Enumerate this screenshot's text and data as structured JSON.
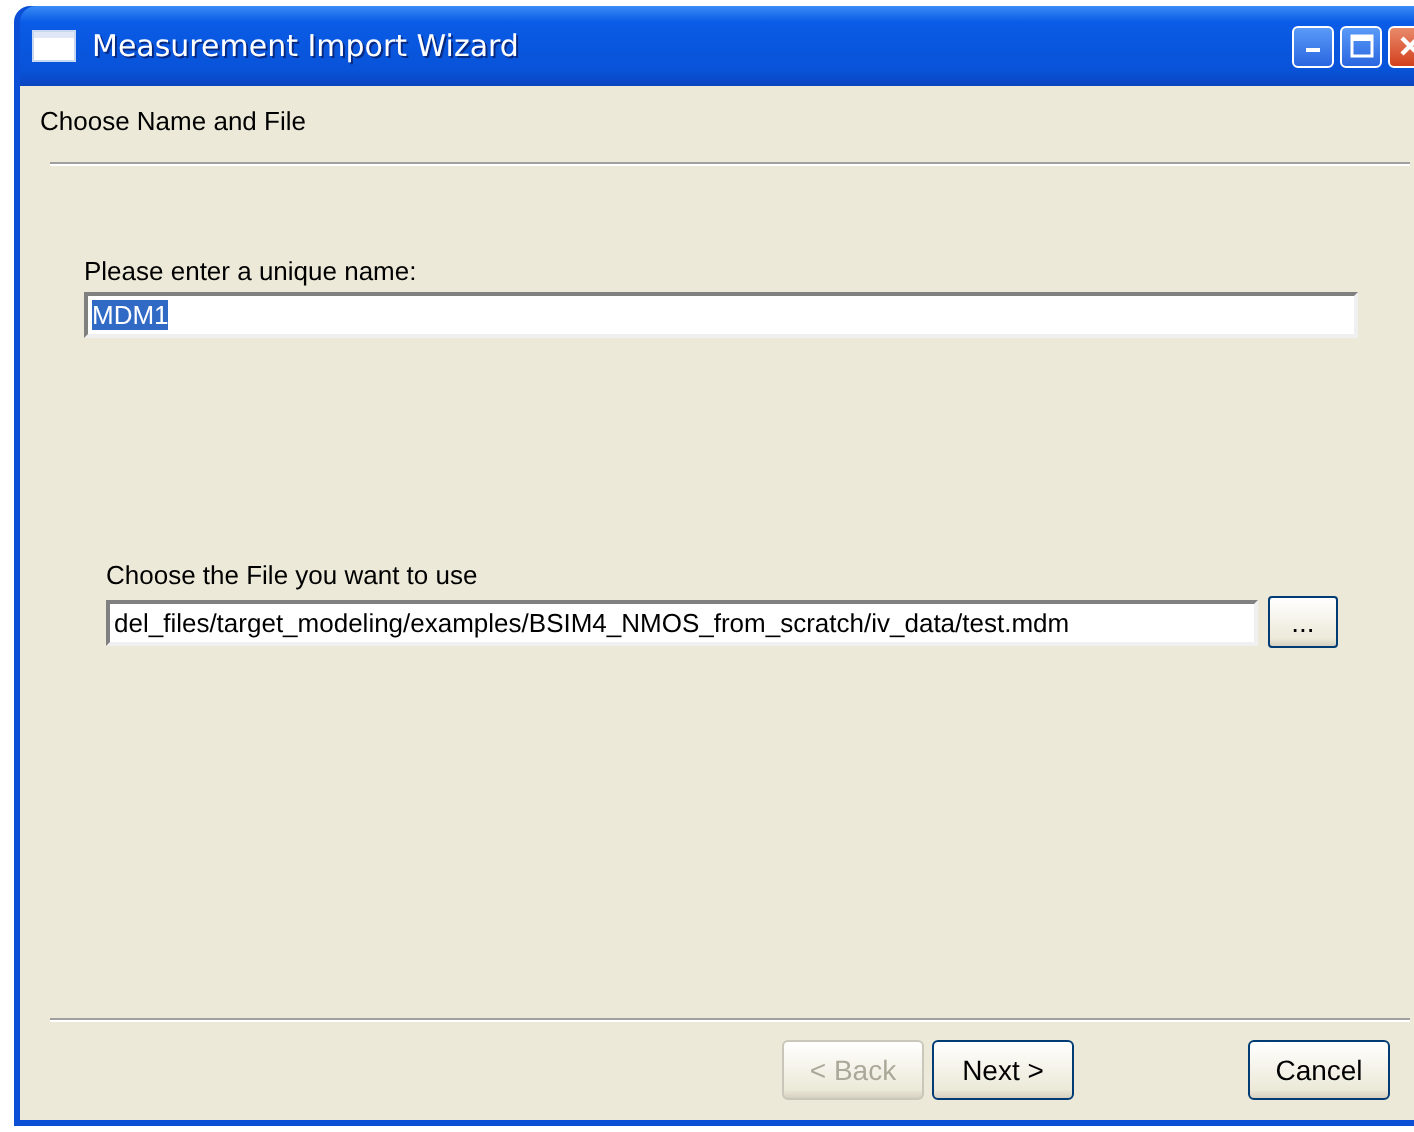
{
  "window": {
    "title": "Measurement Import Wizard"
  },
  "header": {
    "title": "Choose Name and File"
  },
  "name_field": {
    "label": "Please enter a unique name:",
    "value": "MDM1",
    "text_selected": true
  },
  "file_field": {
    "label": "Choose the File you want to use",
    "value": "del_files/target_modeling/examples/BSIM4_NMOS_from_scratch/iv_data/test.mdm",
    "browse_label": "..."
  },
  "buttons": [
    {
      "label": "< Back",
      "kind": "nav",
      "disabled": true
    },
    {
      "label": "Next >",
      "kind": "nav",
      "disabled": false
    },
    {
      "label": "Cancel",
      "kind": "cancel",
      "disabled": false
    }
  ]
}
